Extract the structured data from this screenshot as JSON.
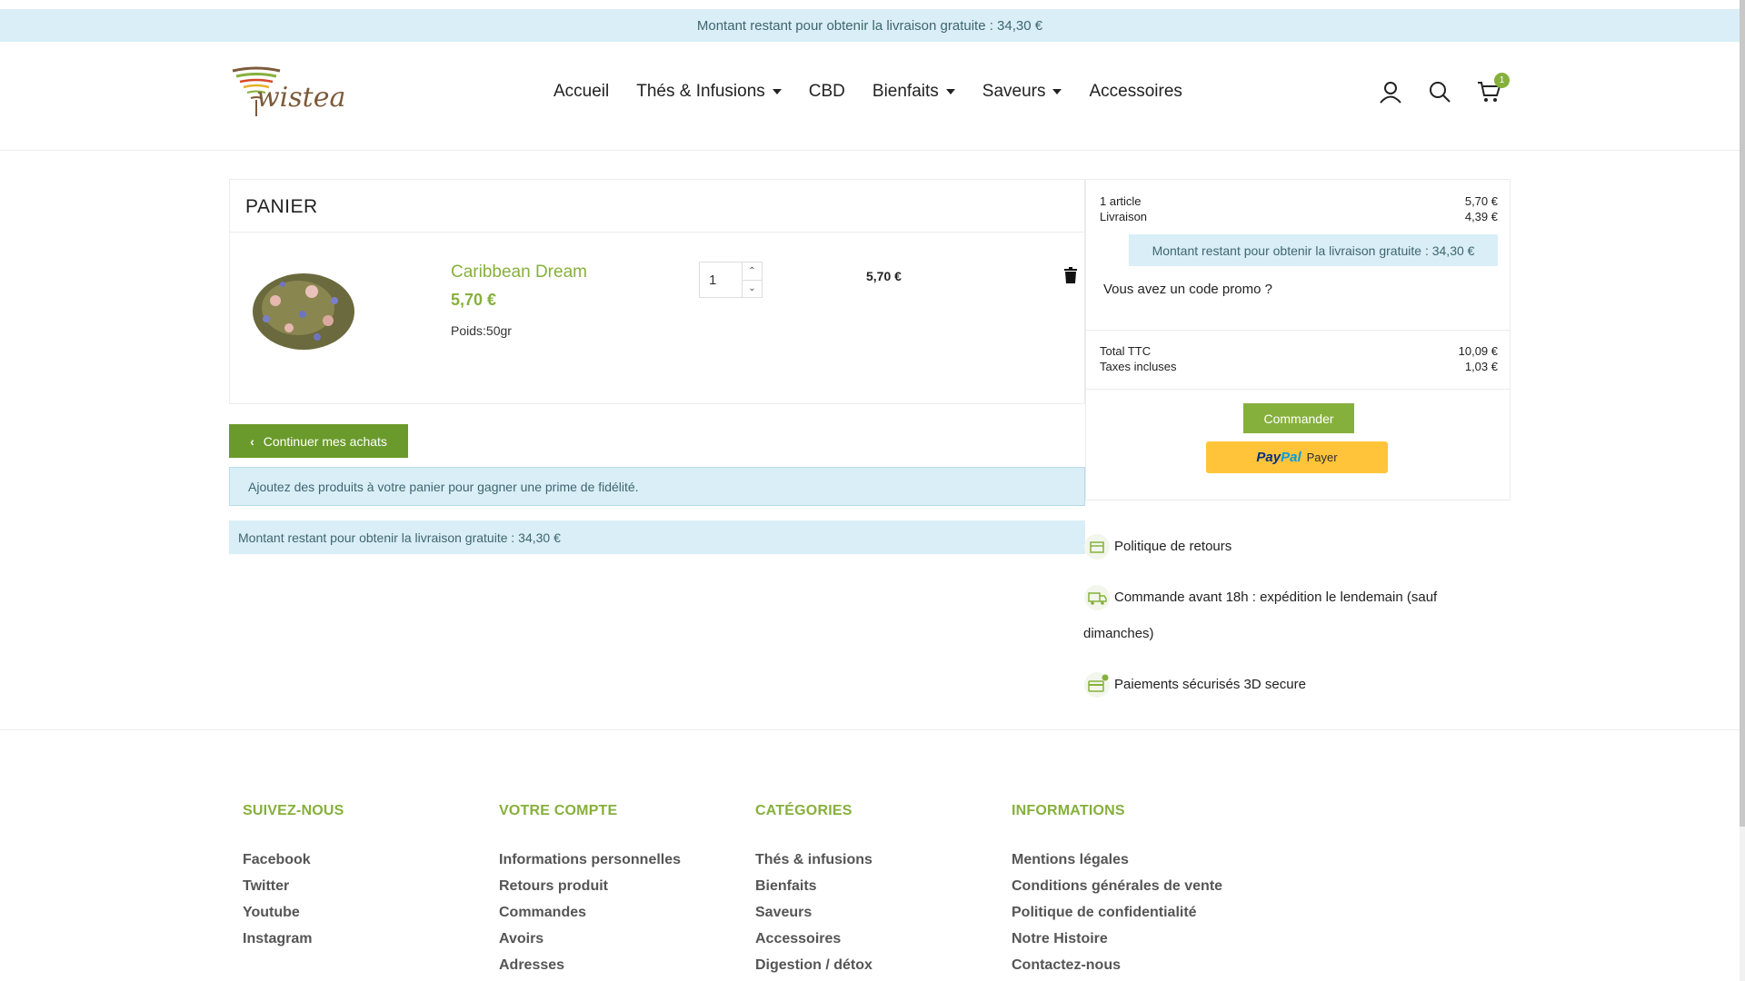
{
  "topbar": {
    "text": "Montant restant pour obtenir la livraison gratuite : 34,30 €"
  },
  "logo": {
    "text": "wistea"
  },
  "nav": {
    "items": [
      {
        "label": "Accueil",
        "dropdown": false
      },
      {
        "label": "Thés & Infusions",
        "dropdown": true
      },
      {
        "label": "CBD",
        "dropdown": false
      },
      {
        "label": "Bienfaits",
        "dropdown": true
      },
      {
        "label": "Saveurs",
        "dropdown": true
      },
      {
        "label": "Accessoires",
        "dropdown": false
      }
    ]
  },
  "header": {
    "cart_count": "1"
  },
  "cart": {
    "title": "PANIER",
    "product": {
      "name": "Caribbean Dream",
      "price": "5,70 €",
      "weight": "Poids:50gr",
      "quantity": "1",
      "line_total": "5,70 €"
    },
    "continue_label": "Continuer mes achats",
    "loyalty_text": "Ajoutez des produits à votre panier pour gagner une prime de fidélité.",
    "shipping_note": "Montant restant pour obtenir la livraison gratuite : 34,30 €"
  },
  "summary": {
    "articles_label": "1 article",
    "articles_value": "5,70 €",
    "shipping_label": "Livraison",
    "shipping_value": "4,39 €",
    "shipping_note": "Montant restant pour obtenir la livraison gratuite : 34,30 €",
    "promo": "Vous avez un code promo ?",
    "total_label": "Total TTC",
    "total_value": "10,09 €",
    "taxes_label": "Taxes incluses",
    "taxes_value": "1,03 €",
    "order_button": "Commander",
    "paypal_pay": "Pay",
    "paypal_pal": "Pal",
    "paypal_button": "Payer"
  },
  "reassurance": [
    "Politique de retours",
    "Commande avant 18h : expédition le lendemain (sauf dimanches)",
    "Paiements sécurisés 3D secure"
  ],
  "footer": {
    "columns": [
      {
        "title": "SUIVEZ-NOUS",
        "links": [
          "Facebook",
          "Twitter",
          "Youtube",
          "Instagram"
        ]
      },
      {
        "title": "VOTRE COMPTE",
        "links": [
          "Informations personnelles",
          "Retours produit",
          "Commandes",
          "Avoirs",
          "Adresses"
        ]
      },
      {
        "title": "CATÉGORIES",
        "links": [
          "Thés & infusions",
          "Bienfaits",
          "Saveurs",
          "Accessoires",
          "Digestion / détox"
        ]
      },
      {
        "title": "INFORMATIONS",
        "links": [
          "Mentions légales",
          "Conditions générales de vente",
          "Politique de confidentialité",
          "Notre Histoire",
          "Contactez-nous"
        ]
      }
    ]
  },
  "colors": {
    "accent": "#86b03c",
    "info_bg": "#d9eef7",
    "info_text": "#40666f"
  },
  "icons": [
    "user-icon",
    "search-icon",
    "cart-icon",
    "trash-icon",
    "chevron-left-icon",
    "return-box-icon",
    "delivery-truck-icon",
    "secure-card-icon"
  ]
}
